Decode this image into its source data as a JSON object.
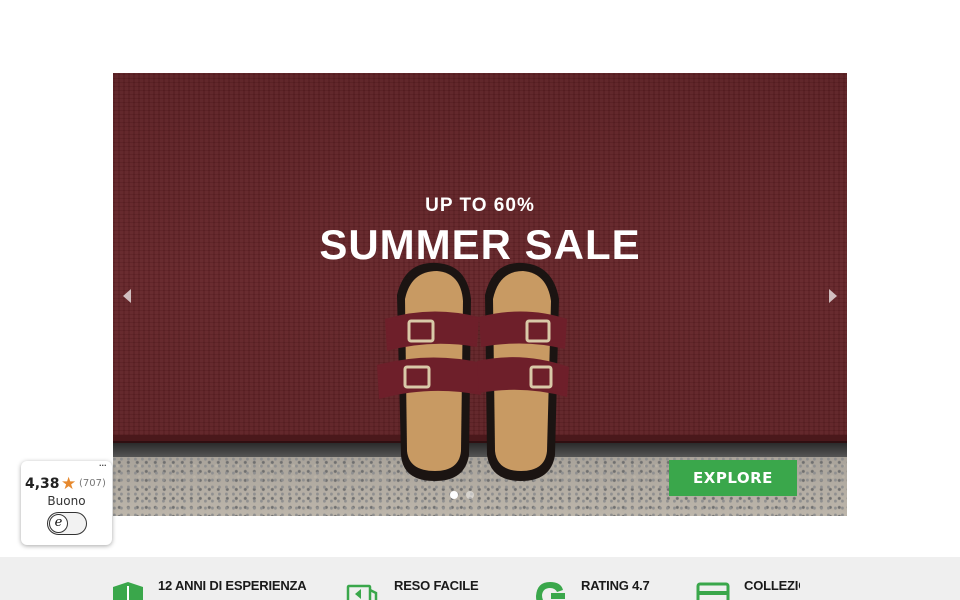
{
  "hero": {
    "kicker": "UP TO 60%",
    "title": "SUMMER SALE",
    "cta_label": "EXPLORE",
    "slides_count": 2,
    "active_slide": 1,
    "colors": {
      "wall": "#5e1f22",
      "cta": "#3aa74b"
    }
  },
  "trust_badge": {
    "more": "···",
    "score": "4,38",
    "star": "★",
    "count": "(707)",
    "label": "Buono",
    "logo_letter": "e",
    "colors": {
      "star": "#e6892e"
    }
  },
  "features": [
    {
      "icon": "shield-icon",
      "label": "12 ANNI DI ESPERIENZA"
    },
    {
      "icon": "return-box-icon",
      "label": "RESO FACILE"
    },
    {
      "icon": "google-g-icon",
      "label": "RATING 4.7"
    },
    {
      "icon": "laptop-icon",
      "label": "COLLEZIONA PUN"
    }
  ],
  "colors": {
    "feature_icon": "#3aa74b",
    "features_bg": "#efefef"
  }
}
